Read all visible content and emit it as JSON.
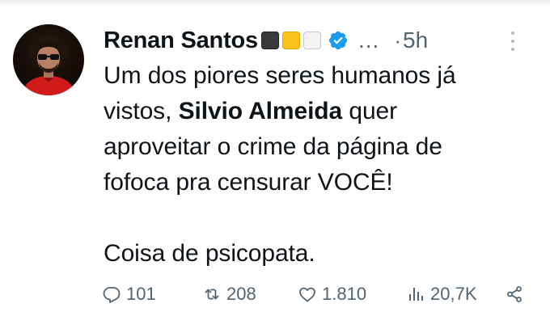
{
  "author": {
    "name": "Renan Santos",
    "flag_squares": [
      "black",
      "yellow",
      "white"
    ],
    "verified_icon": "verified-badge-icon",
    "more_label": "...",
    "separator": "·",
    "time": "5h"
  },
  "tweet": {
    "line1": "Um dos piores seres humanos já",
    "line2_before": "vistos, ",
    "line2_bold": "Silvio Almeida",
    "line2_after": " quer",
    "line3": "aproveitar o crime da página de",
    "line4": "fofoca pra censurar VOCÊ!",
    "line5": "Coisa de psicopata."
  },
  "actions": {
    "replies": "101",
    "reposts": "208",
    "likes": "1.810",
    "views": "20,7K"
  },
  "colors": {
    "text": "#0f1419",
    "muted": "#536471",
    "verified": "#1d9bf0",
    "flag_yellow": "#fcc21b"
  }
}
